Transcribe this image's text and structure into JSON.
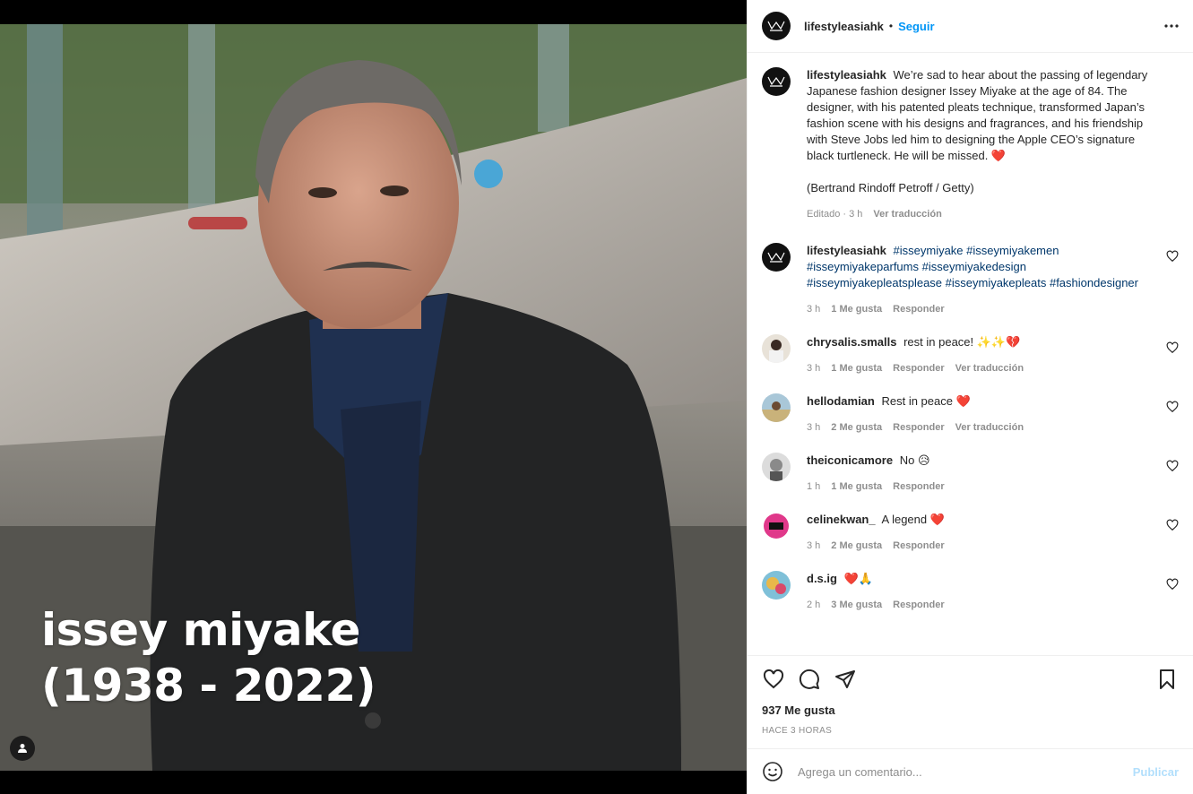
{
  "media": {
    "overlay_line1": "issey miyake",
    "overlay_line2": "(1938 - 2022)"
  },
  "header": {
    "username": "lifestyleasiahk",
    "separator": "•",
    "follow_label": "Seguir"
  },
  "caption": {
    "username": "lifestyleasiahk",
    "text": "We’re sad to hear about the passing of legendary Japanese fashion designer Issey Miyake at the age of 84. The designer, with his patented pleats technique, transformed Japan’s fashion scene with his designs and fragrances, and his friendship with Steve Jobs led him to designing the Apple CEO’s signature black turtleneck. He will be missed. ❤️",
    "credit": "(Bertrand Rindoff Petroff / Getty)",
    "time": "Editado · 3 h",
    "translate": "Ver traducción"
  },
  "comments": [
    {
      "username": "lifestyleasiahk",
      "text": "#isseymiyake #isseymiyakemen #isseymiyakeparfums #isseymiyakedesign #isseymiyakepleatsplease #isseymiyakepleats #fashiondesigner",
      "time": "3 h",
      "likes": "1 Me gusta",
      "reply": "Responder",
      "translate": ""
    },
    {
      "username": "chrysalis.smalls",
      "text": "rest in peace! ✨✨💔",
      "time": "3 h",
      "likes": "1 Me gusta",
      "reply": "Responder",
      "translate": "Ver traducción"
    },
    {
      "username": "hellodamian",
      "text": "Rest in peace ❤️",
      "time": "3 h",
      "likes": "2 Me gusta",
      "reply": "Responder",
      "translate": "Ver traducción"
    },
    {
      "username": "theiconicamore",
      "text": "No 😥",
      "time": "1 h",
      "likes": "1 Me gusta",
      "reply": "Responder",
      "translate": ""
    },
    {
      "username": "celinekwan_",
      "text": "A legend ❤️",
      "time": "3 h",
      "likes": "2 Me gusta",
      "reply": "Responder",
      "translate": ""
    },
    {
      "username": "d.s.ig",
      "text": "❤️🙏",
      "time": "2 h",
      "likes": "3 Me gusta",
      "reply": "Responder",
      "translate": ""
    }
  ],
  "stats": {
    "likes": "937 Me gusta",
    "posted": "HACE 3 HORAS"
  },
  "composer": {
    "placeholder": "Agrega un comentario...",
    "publish_label": "Publicar"
  },
  "icons": {
    "like": "heart-icon",
    "comment": "comment-icon",
    "share": "share-icon",
    "save": "bookmark-icon",
    "more": "more-icon",
    "emoji": "emoji-icon",
    "tag": "user-tag-icon"
  },
  "colors": {
    "accent": "#0095f6",
    "publish_disabled": "#b2dffc",
    "hashtag": "#00376b",
    "muted": "#8e8e8e"
  }
}
